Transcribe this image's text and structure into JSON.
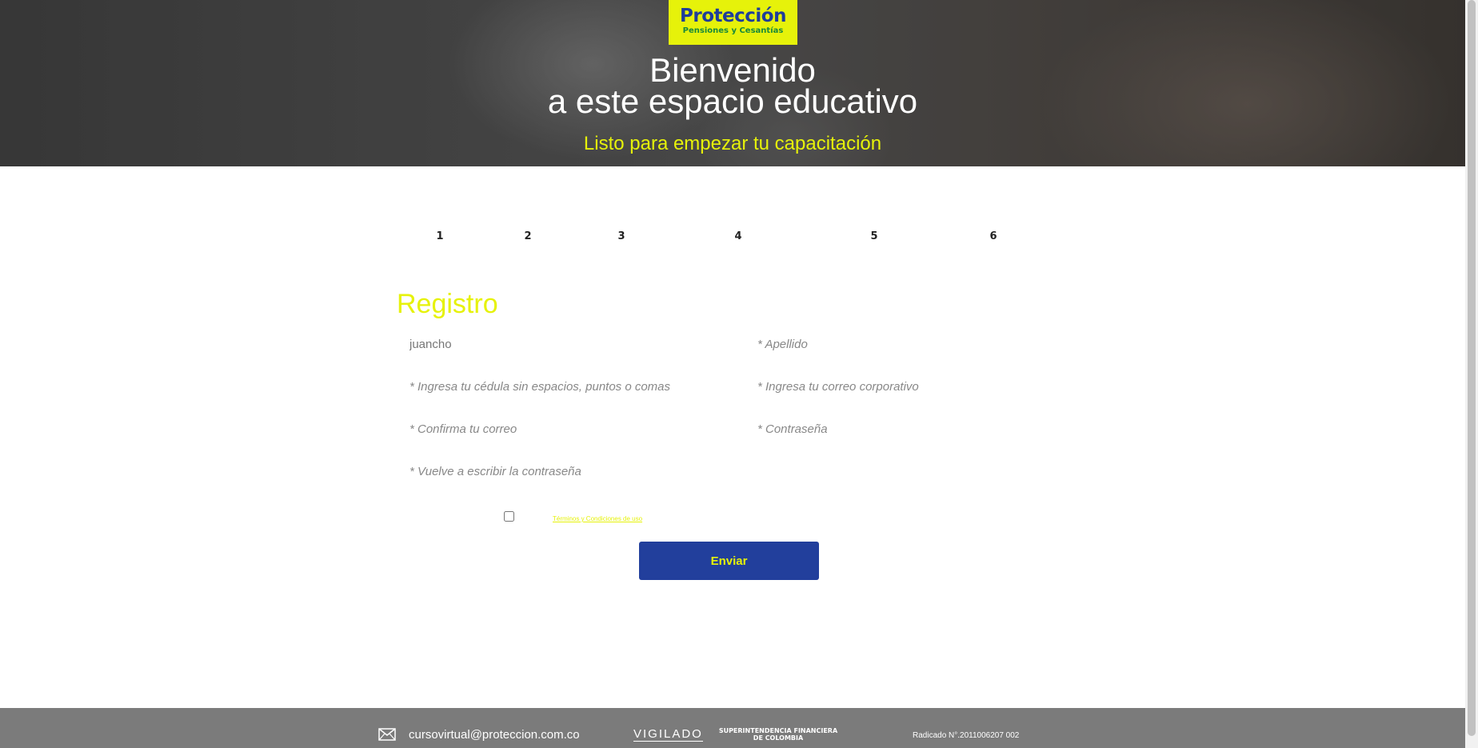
{
  "hero": {
    "logo_title": "Protección",
    "logo_tagline": "Pensiones y Cesantías",
    "heading_line1": "Bienvenido",
    "heading_line2": "a este espacio educativo",
    "subtitle": "Listo para empezar tu capacitación"
  },
  "steps": [
    "1",
    "2",
    "3",
    "4",
    "5",
    "6"
  ],
  "form": {
    "title": "Registro",
    "nombre_value": "juancho",
    "apellido_placeholder": "* Apellido",
    "cedula_placeholder": "* Ingresa tu cédula sin espacios, puntos o comas",
    "correo_placeholder": "* Ingresa tu correo corporativo",
    "confirma_correo_placeholder": "* Confirma tu correo",
    "contrasena_placeholder": "* Contraseña",
    "repite_contrasena_placeholder": "* Vuelve a escribir la contraseña",
    "terms_label": "Términos y Condiciones de uso",
    "submit_label": "Enviar"
  },
  "footer": {
    "email": "cursovirtual@proteccion.com.co",
    "vigilado": "VIGILADO",
    "superfinanciera_line1": "SUPERINTENDENCIA FINANCIERA",
    "superfinanciera_line2": "DE COLOMBIA",
    "radicado": "Radicado N°.2011006207 002"
  },
  "colors": {
    "accent_yellow": "#e6f20a",
    "brand_blue": "#223f9c",
    "footer_gray": "#7b7b7b"
  }
}
